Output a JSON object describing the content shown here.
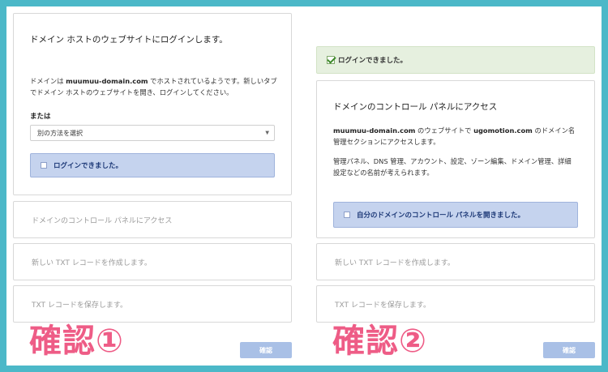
{
  "left": {
    "step1": {
      "title": "ドメイン ホストのウェブサイトにログインします。",
      "desc_prefix": "ドメインは ",
      "domain": "muumuu-domain.com",
      "desc_suffix": " でホストされているようです。新しいタブでドメイン ホストのウェブサイトを開き、ログインしてください。",
      "or_label": "または",
      "select_value": "別の方法を選択",
      "checkbox_label": "ログインできました。"
    },
    "step2_label": "ドメインのコントロール パネルにアクセス",
    "step3_label": "新しい TXT レコードを作成します。",
    "step4_label": "TXT レコードを保存します。",
    "confirm_label": "確認",
    "big_label": "確認①"
  },
  "right": {
    "success_label": "ログインできました。",
    "step2": {
      "title": "ドメインのコントロール パネルにアクセス",
      "domain": "muumuu-domain.com",
      "mid1": " のウェブサイトで ",
      "site": "ugomotion.com",
      "mid2": " のドメイン名管理セクションにアクセスします。",
      "desc2": "管理パネル、DNS 管理、アカウント、設定、ゾーン編集、ドメイン管理、詳細設定などの名前が考えられます。",
      "checkbox_label": "自分のドメインのコントロール パネルを開きました。"
    },
    "step3_label": "新しい TXT レコードを作成します。",
    "step4_label": "TXT レコードを保存します。",
    "confirm_label": "確認",
    "big_label": "確認②"
  },
  "colors": {
    "frame": "#4cb8c8",
    "accent_label": "#ee5c86",
    "checkbox_bg": "#c5d3ee",
    "success_bg": "#e6f0df",
    "confirm_bg": "#a9c0e6"
  }
}
